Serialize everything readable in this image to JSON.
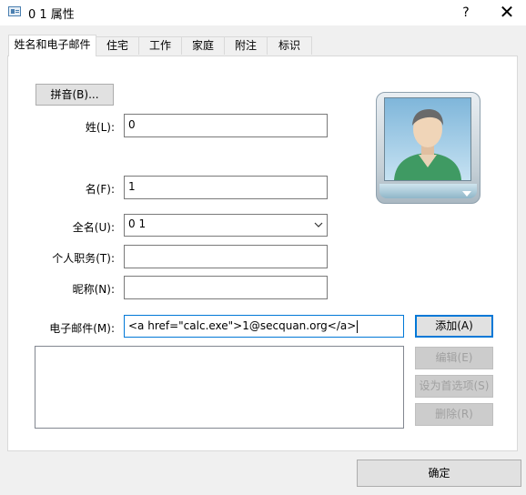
{
  "window": {
    "title": "0 1 属性",
    "help_glyph": "?",
    "close_glyph": "✕"
  },
  "tabs": [
    {
      "label": "姓名和电子邮件",
      "active": true
    },
    {
      "label": "住宅"
    },
    {
      "label": "工作"
    },
    {
      "label": "家庭"
    },
    {
      "label": "附注"
    },
    {
      "label": "标识"
    }
  ],
  "name_section": {
    "pinyin_button": "拼音(B)...",
    "last_name_label": "姓(L):",
    "last_name_value": "0",
    "first_name_label": "名(F):",
    "first_name_value": "1",
    "full_name_label": "全名(U):",
    "full_name_value": "0 1",
    "title_label": "个人职务(T):",
    "title_value": "",
    "nickname_label": "昵称(N):",
    "nickname_value": ""
  },
  "email_section": {
    "label": "电子邮件(M):",
    "value": "<a href=\"calc.exe\">1@secquan.org</a>",
    "add_button": "添加(A)",
    "edit_button": "编辑(E)",
    "default_button": "设为首选项(S)",
    "delete_button": "删除(R)"
  },
  "footer": {
    "ok_button": "确定"
  },
  "avatar": {
    "icon": "contact-person-icon"
  },
  "colors": {
    "focus_accent": "#0078d7",
    "disabled_text": "#a0a0a0"
  }
}
